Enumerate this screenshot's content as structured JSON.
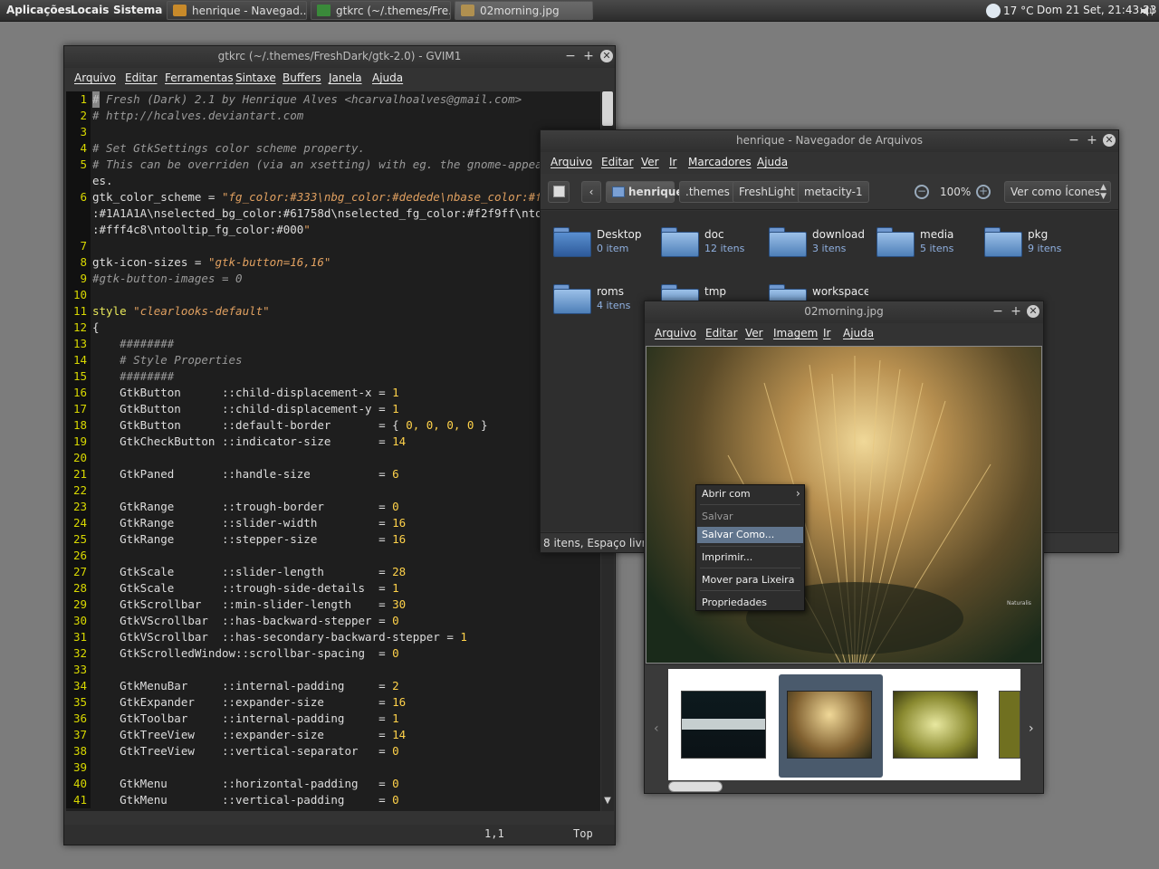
{
  "panel": {
    "menus": [
      "Aplicações",
      "Locais",
      "Sistema"
    ],
    "tasks": [
      "henrique - Navegad...",
      "gtkrc (~/.themes/Fre...",
      "02morning.jpg"
    ],
    "temperature": "17 °C",
    "clock": "Dom 21 Set, 21:43:23"
  },
  "gvim": {
    "title": "gtkrc (~/.themes/FreshDark/gtk-2.0) - GVIM1",
    "menu": [
      "Arquivo",
      "Editar",
      "Ferramentas",
      "Sintaxe",
      "Buffers",
      "Janela",
      "Ajuda"
    ],
    "status_pos": "1,1",
    "status_top": "Top",
    "gutter": [
      "1",
      "2",
      "3",
      "4",
      "5",
      "",
      "6",
      "",
      "",
      "7",
      "8",
      "9",
      "10",
      "11",
      "12",
      "13",
      "14",
      "15",
      "16",
      "17",
      "18",
      "19",
      "20",
      "21",
      "22",
      "23",
      "24",
      "25",
      "26",
      "27",
      "28",
      "29",
      "30",
      "31",
      "32",
      "33",
      "34",
      "35",
      "36",
      "37",
      "38",
      "39",
      "40",
      "41"
    ],
    "lines": [
      "# Fresh (Dark) 2.1 by Henrique Alves <hcarvalhoalves@gmail.com>",
      "# http://hcalves.deviantart.com",
      "",
      "# Set GtkSettings color scheme property.",
      "# This can be overriden (via an xsetting) with eg. the gnome-appearance-properti",
      "es.",
      "gtk_color_scheme = \"fg_color:#333\\nbg_color:#dedede\\nbase_color:#fff\\ntext_color",
      ":#1A1A1A\\nselected_bg_color:#61758d\\nselected_fg_color:#f2f9ff\\ntooltip_bg_color",
      ":#fff4c8\\ntooltip_fg_color:#000\"",
      "",
      "gtk-icon-sizes = \"gtk-button=16,16\"",
      "#gtk-button-images = 0",
      "",
      "style \"clearlooks-default\"",
      "{",
      "    ########",
      "    # Style Properties",
      "    ########",
      "    GtkButton      ::child-displacement-x = 1",
      "    GtkButton      ::child-displacement-y = 1",
      "    GtkButton      ::default-border       = { 0, 0, 0, 0 }",
      "    GtkCheckButton ::indicator-size       = 14",
      "",
      "    GtkPaned       ::handle-size          = 6",
      "",
      "    GtkRange       ::trough-border        = 0",
      "    GtkRange       ::slider-width         = 16",
      "    GtkRange       ::stepper-size         = 16",
      "",
      "    GtkScale       ::slider-length        = 28",
      "    GtkScale       ::trough-side-details  = 1",
      "    GtkScrollbar   ::min-slider-length    = 30",
      "    GtkVScrollbar  ::has-backward-stepper = 0",
      "    GtkVScrollbar  ::has-secondary-backward-stepper = 1",
      "    GtkScrolledWindow::scrollbar-spacing  = 0",
      "",
      "    GtkMenuBar     ::internal-padding     = 2",
      "    GtkExpander    ::expander-size        = 16",
      "    GtkToolbar     ::internal-padding     = 1",
      "    GtkTreeView    ::expander-size        = 14",
      "    GtkTreeView    ::vertical-separator   = 0",
      "",
      "    GtkMenu        ::horizontal-padding   = 0",
      "    GtkMenu        ::vertical-padding     = 0"
    ]
  },
  "nautilus": {
    "title": "henrique - Navegador de Arquivos",
    "menu": [
      "Arquivo",
      "Editar",
      "Ver",
      "Ir",
      "Marcadores",
      "Ajuda"
    ],
    "path": [
      "henrique",
      ".themes",
      "FreshLight",
      "metacity-1"
    ],
    "zoom": "100%",
    "view_mode": "Ver como Ícones",
    "statusbar": "8 itens, Espaço livre: 2",
    "folders": [
      {
        "name": "Desktop",
        "count": "0 item"
      },
      {
        "name": "doc",
        "count": "12 itens"
      },
      {
        "name": "download",
        "count": "3 itens"
      },
      {
        "name": "media",
        "count": "5 itens"
      },
      {
        "name": "pkg",
        "count": "9 itens"
      },
      {
        "name": "roms",
        "count": "4 itens"
      },
      {
        "name": "tmp",
        "count": ""
      },
      {
        "name": "workspace",
        "count": ""
      }
    ]
  },
  "eog": {
    "title": "02morning.jpg",
    "menu": [
      "Arquivo",
      "Editar",
      "Ver",
      "Imagem",
      "Ir",
      "Ajuda"
    ],
    "context_menu": [
      "Abrir com",
      "Salvar",
      "Salvar Como...",
      "Imprimir...",
      "Mover para Lixeira",
      "Propriedades"
    ],
    "watermark": "Naturalis"
  },
  "colors": {
    "selection": "#61758d",
    "line_number": "#d8d800",
    "string": "#e0a060",
    "comment": "#9a9a9a",
    "keyword": "#e8e85a"
  }
}
